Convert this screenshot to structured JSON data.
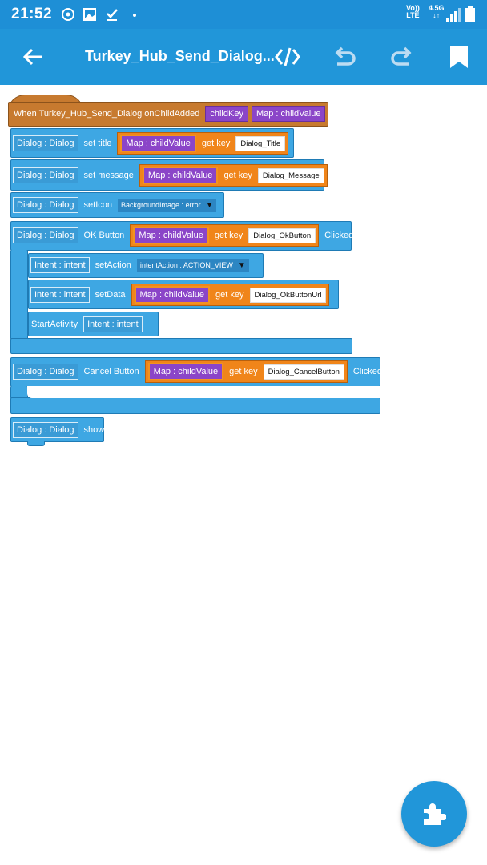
{
  "status": {
    "time": "21:52",
    "volte": "Vo))",
    "lte": "LTE",
    "network": "4.5G"
  },
  "toolbar": {
    "title": "Turkey_Hub_Send_Dialog..."
  },
  "blocks": {
    "event": {
      "label": "When Turkey_Hub_Send_Dialog onChildAdded",
      "param1": "childKey",
      "param2": "Map : childValue"
    },
    "set_title": {
      "comp": "Dialog : Dialog",
      "label": "set title",
      "map": "Map : childValue",
      "get": "get key",
      "key": "Dialog_Title"
    },
    "set_message": {
      "comp": "Dialog : Dialog",
      "label": "set message",
      "map": "Map : childValue",
      "get": "get key",
      "key": "Dialog_Message"
    },
    "set_icon": {
      "comp": "Dialog : Dialog",
      "label": "setIcon",
      "value": "BackgroundImage : error"
    },
    "ok_button": {
      "comp": "Dialog : Dialog",
      "label": "OK Button",
      "map": "Map : childValue",
      "get": "get key",
      "key": "Dialog_OkButton",
      "suffix": "Clicked"
    },
    "set_action": {
      "comp": "Intent : intent",
      "label": "setAction",
      "value": "intentAction : ACTION_VIEW"
    },
    "set_data": {
      "comp": "Intent : intent",
      "label": "setData",
      "map": "Map : childValue",
      "get": "get key",
      "key": "Dialog_OkButtonUrl"
    },
    "start_activity": {
      "label": "StartActivity",
      "comp": "Intent : intent"
    },
    "cancel_button": {
      "comp": "Dialog : Dialog",
      "label": "Cancel Button",
      "map": "Map : childValue",
      "get": "get key",
      "key": "Dialog_CancelButton",
      "suffix": "Clicked"
    },
    "show": {
      "comp": "Dialog : Dialog",
      "label": "show"
    }
  },
  "icons": {
    "back": "arrow-left-icon",
    "code": "code-icon",
    "undo": "undo-icon",
    "redo": "redo-icon",
    "bookmark": "bookmark-icon",
    "fab": "puzzle-piece-icon"
  },
  "colors": {
    "toolbar": "#2196d9",
    "block_blue": "#3ea7e3",
    "event_brown": "#c77a2f",
    "map_purple": "#8b45c8",
    "getkey_orange": "#f0851a"
  }
}
